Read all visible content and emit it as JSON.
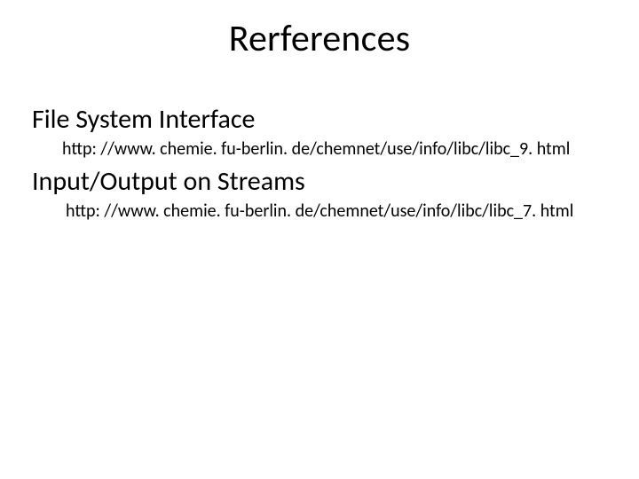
{
  "title": "Rerferences",
  "sections": [
    {
      "heading": "File System Interface",
      "url": "http: //www. chemie. fu-berlin. de/chemnet/use/info/libc/libc_9. html"
    },
    {
      "heading": "Input/Output on Streams",
      "url": "http: //www. chemie. fu-berlin. de/chemnet/use/info/libc/libc_7. html"
    }
  ]
}
